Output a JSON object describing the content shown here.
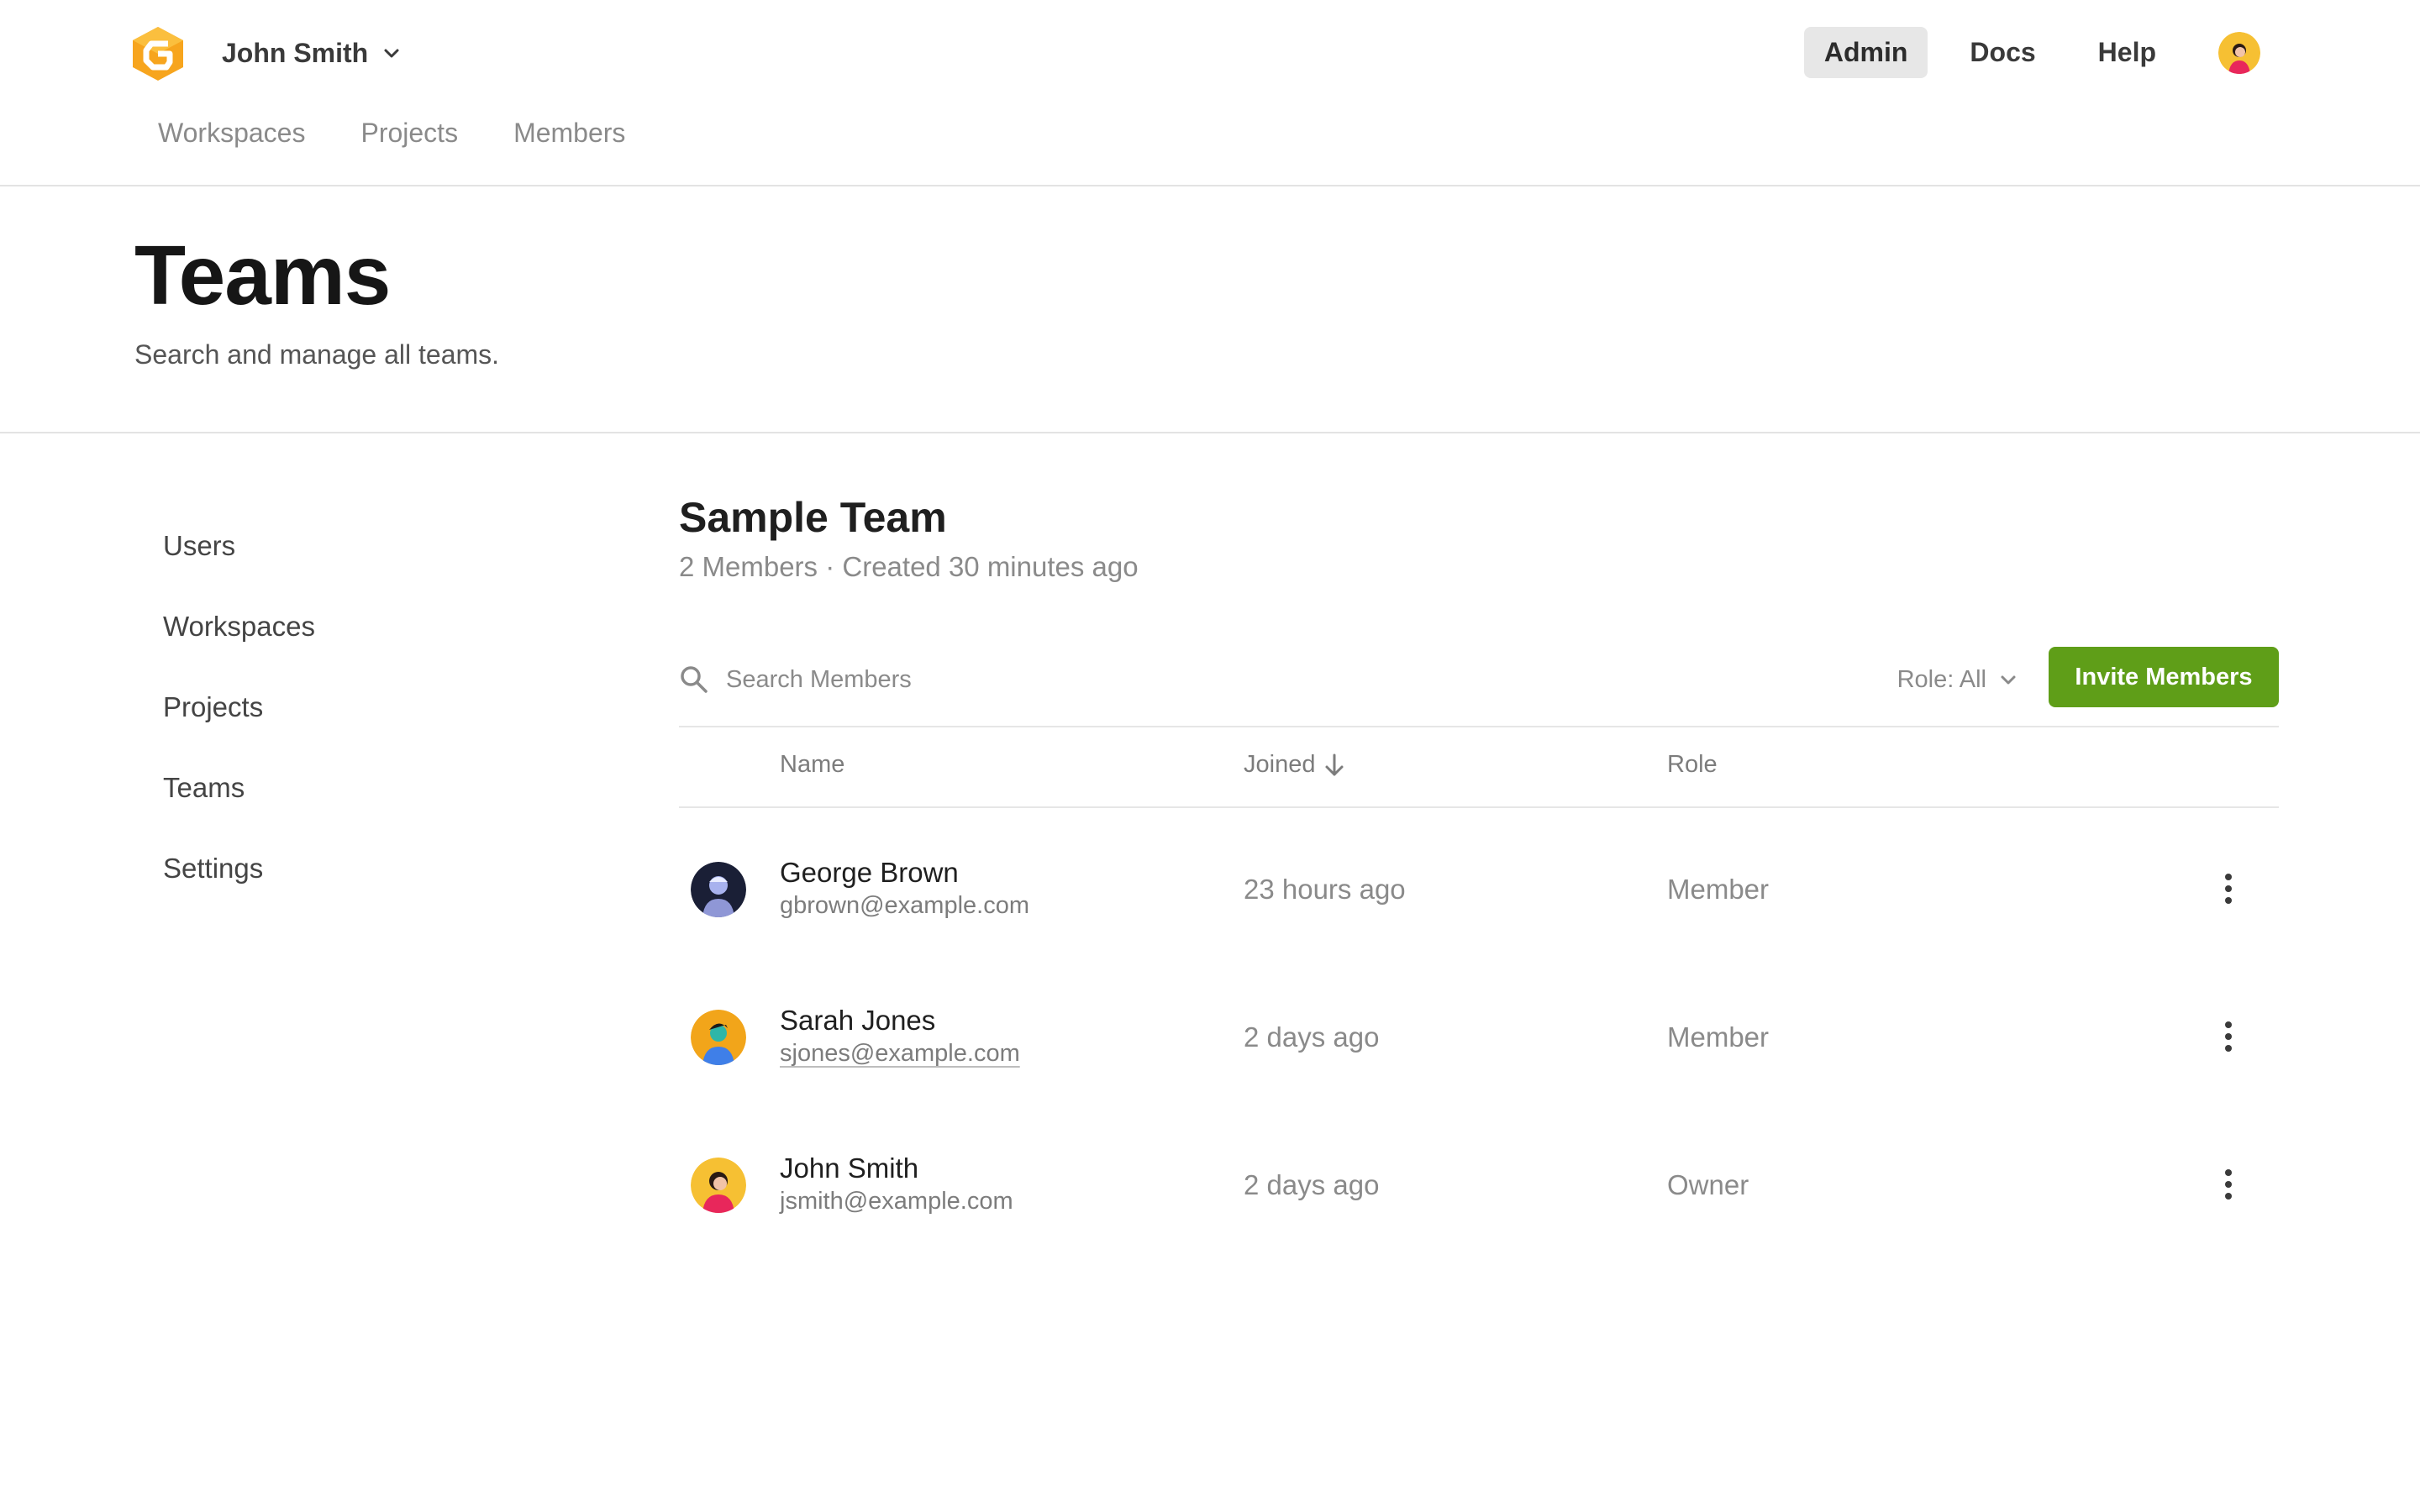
{
  "topbar": {
    "user_name": "John Smith",
    "nav": [
      {
        "label": "Admin",
        "active": true
      },
      {
        "label": "Docs",
        "active": false
      },
      {
        "label": "Help",
        "active": false
      }
    ],
    "subnav": [
      "Workspaces",
      "Projects",
      "Members"
    ]
  },
  "header": {
    "title": "Teams",
    "subtitle": "Search and manage all teams."
  },
  "sidebar": {
    "items": [
      "Users",
      "Workspaces",
      "Projects",
      "Teams",
      "Settings"
    ]
  },
  "team": {
    "name": "Sample Team",
    "meta": "2 Members · Created 30 minutes ago"
  },
  "toolbar": {
    "search_placeholder": "Search Members",
    "role_filter": "Role: All",
    "invite_label": "Invite Members"
  },
  "table": {
    "columns": {
      "name": "Name",
      "joined": "Joined",
      "role": "Role"
    },
    "rows": [
      {
        "name": "George Brown",
        "email": "gbrown@example.com",
        "joined": "23 hours ago",
        "role": "Member",
        "avatar": "avatar-dark"
      },
      {
        "name": "Sarah Jones",
        "email": "sjones@example.com",
        "joined": "2 days ago",
        "role": "Member",
        "avatar": "avatar-orange"
      },
      {
        "name": "John Smith",
        "email": "jsmith@example.com",
        "joined": "2 days ago",
        "role": "Owner",
        "avatar": "avatar-yellow"
      }
    ]
  },
  "colors": {
    "brand": "#f5a21b",
    "invite_button": "#5f9e18",
    "active_nav_bg": "#e7e7e7"
  }
}
